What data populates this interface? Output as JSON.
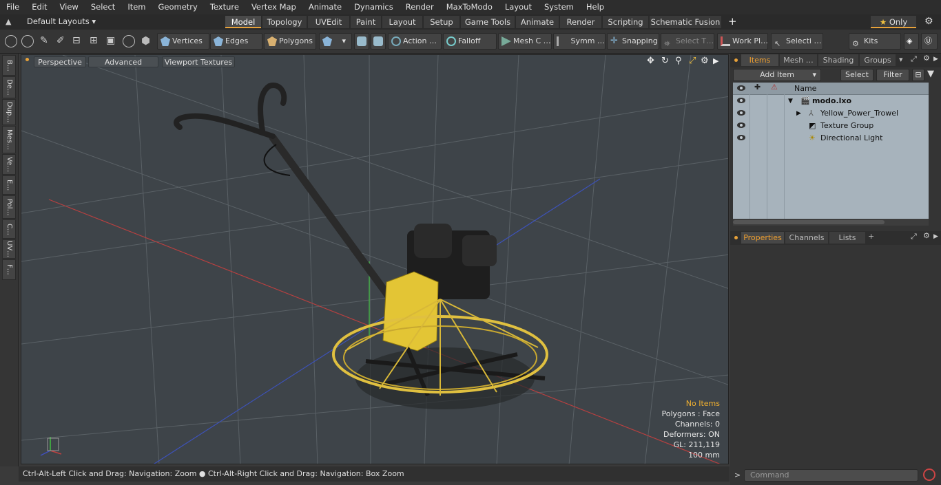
{
  "menu": [
    "File",
    "Edit",
    "View",
    "Select",
    "Item",
    "Geometry",
    "Texture",
    "Vertex Map",
    "Animate",
    "Dynamics",
    "Render",
    "MaxToModo",
    "Layout",
    "System",
    "Help"
  ],
  "layouts_label": "Default Layouts",
  "layout_tabs": [
    "Model",
    "Topology",
    "UVEdit",
    "Paint",
    "Layout",
    "Setup",
    "Game Tools",
    "Animate",
    "Render",
    "Scripting",
    "Schematic Fusion"
  ],
  "only_label": "Only",
  "toolbar": {
    "vertices": "Vertices",
    "edges": "Edges",
    "polygons": "Polygons",
    "action": "Action",
    "falloff": "Falloff",
    "mesh": "Mesh C …",
    "symm": "Symm …",
    "snapping": "Snapping",
    "select_t": "Select T…",
    "work_pl": "Work Pl…",
    "selecti": "Selecti …",
    "kits": "Kits"
  },
  "left_tabs": [
    "B…",
    "De…",
    "Dup…",
    "Mes…",
    "Ve…",
    "E…",
    "Pol…",
    "C…",
    "UV…",
    "F…"
  ],
  "viewport": {
    "perspective": "Perspective",
    "advanced": "Advanced",
    "viewport_textures": "Viewport Textures",
    "info": {
      "no_items": "No Items",
      "polygons": "Polygons : Face",
      "channels": "Channels: 0",
      "deformers": "Deformers: ON",
      "gl": "GL: 211,119",
      "scale": "100 mm"
    }
  },
  "status_text": "Ctrl-Alt-Left Click and Drag: Navigation: Zoom ● Ctrl-Alt-Right Click and Drag: Navigation: Box Zoom",
  "right": {
    "tabs": [
      "Items",
      "Mesh …",
      "Shading",
      "Groups"
    ],
    "add_item": "Add Item",
    "select": "Select",
    "filter": "Filter",
    "name_header": "Name",
    "items": [
      "modo.lxo",
      "Yellow_Power_Trowel",
      "Texture Group",
      "Directional Light"
    ],
    "prop_tabs": [
      "Properties",
      "Channels",
      "Lists"
    ],
    "command_placeholder": "Command"
  },
  "colors": {
    "accent": "#f0a030",
    "trowel_yellow": "#e8c840"
  }
}
